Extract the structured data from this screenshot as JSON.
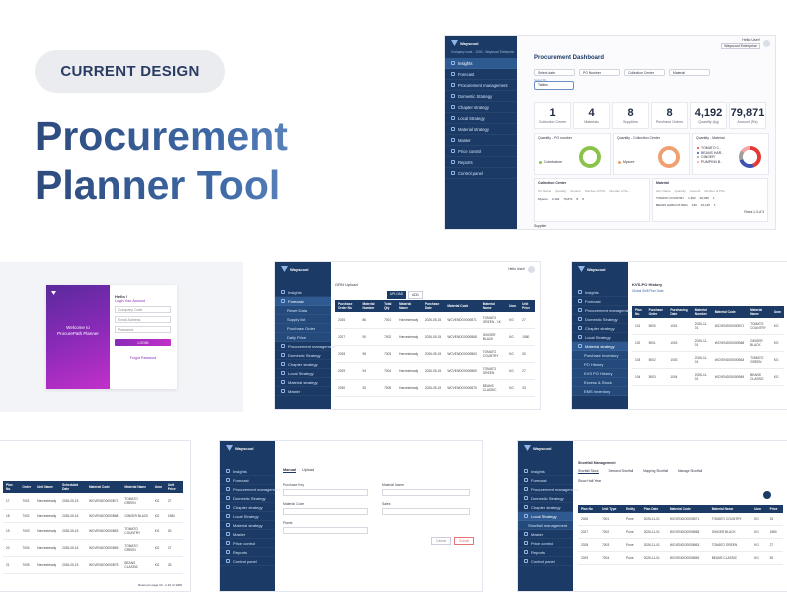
{
  "hero": {
    "badge": "CURRENT DESIGN",
    "title_line1": "Procurement",
    "title_line2": "Planner Tool"
  },
  "dashboard": {
    "brand": "Wayscool",
    "company": "Company code - 1000 - Wayscool Enterprise",
    "nav": [
      "Insights",
      "Forecast",
      "Procurement management",
      "Domestic Strategy",
      "Chapter strategy",
      "Local Strategy",
      "Material strategy",
      "Master",
      "Price control",
      "Reports",
      "Control panel"
    ],
    "user_name": "Hello User!",
    "user_sub": "Wayscool Enterprise",
    "title": "Procurement Dashboard",
    "filters": [
      "Select date",
      "PO Number",
      "Collection Center",
      "Material"
    ],
    "select_by_label": "Select By",
    "select_by_value": "Tables",
    "kpis": [
      {
        "value": "1",
        "label": "Collection Center"
      },
      {
        "value": "4",
        "label": "Materials"
      },
      {
        "value": "8",
        "label": "Suppliers"
      },
      {
        "value": "8",
        "label": "Purchase Orders"
      },
      {
        "value": "4,192",
        "label": "Quantity (kg)"
      },
      {
        "value": "79,871",
        "label": "Amount (Rs)"
      }
    ],
    "donut_titles": [
      "Quantity - PO number",
      "Quantity - Collection Center",
      "Quantity - Material"
    ],
    "donut_legends": [
      "Coimbatore",
      "Mysore"
    ],
    "material_legend": [
      "TOMATO C..",
      "BEANS HAR..",
      "GINGER",
      "PUMPKIN B.."
    ],
    "lower_titles": [
      "Collection Center",
      "Material"
    ],
    "cc_headers": [
      "CC Name",
      "Quantity",
      "Amount",
      "Number of POs",
      "Number of Su..."
    ],
    "cc_row": [
      "Mysore",
      "4,192",
      "79,871",
      "8",
      "8"
    ],
    "mat_headers": [
      "Item Name",
      "Quantity",
      "Amount",
      "Number of POs"
    ],
    "mat_rows": [
      [
        "TOMATO COUNTRY",
        "1,352",
        "36,035",
        "1"
      ],
      [
        "BEANS HARICOT REG",
        "449",
        "10,125",
        "1"
      ]
    ],
    "pager": "Rows 1-3 of 3",
    "footer_label": "Supplier"
  },
  "login": {
    "welcome_1": "Welcome to",
    "welcome_2": "ProcurePath Planner",
    "hello": "Hello !",
    "sub": "Login Your Account",
    "fields": [
      "Company Code",
      "Email Address",
      "Password"
    ],
    "button": "LOGIN",
    "forgot": "Forgot Password"
  },
  "grn": {
    "title": "GRN Upload",
    "tab_active": "UPLOAD",
    "tab_other": "ADD",
    "headers": [
      "Purchase Order No",
      "Material Number",
      "Total Qty",
      "Material Name",
      "Purchase Date",
      "Material Code",
      "Material Name",
      "Uom",
      "Unit Price"
    ],
    "rows": [
      [
        "2026",
        "86",
        "7001",
        "Harvestready",
        "2026-05-15",
        "WCVENDO0000B71",
        "TOMATO GREEN - 1K",
        "KG",
        "27"
      ],
      [
        "2027",
        "90",
        "7002",
        "Harvestready",
        "2026-05-15",
        "WCVENDO0000B68",
        "GINGER BLACK",
        "KG",
        "1580"
      ],
      [
        "2028",
        "96",
        "7003",
        "Harvestready",
        "2026-05-15",
        "WCVENDO0000B63",
        "TOMATO COUNTRY",
        "KG",
        "30"
      ],
      [
        "2029",
        "94",
        "7004",
        "Harvestready",
        "2026-05-15",
        "WCVENDO0000B69",
        "TOMATO GREEN",
        "KG",
        "27"
      ],
      [
        "2030",
        "92",
        "7005",
        "Harvestready",
        "2026-05-15",
        "WCVENDO0000B75",
        "BEANS CLASSIC",
        "KG",
        "33"
      ]
    ],
    "submenu": [
      "Reset Data",
      "Supply list",
      "Purchase Order",
      "Daily Price"
    ]
  },
  "kvs": {
    "title": "KVS-PO History",
    "subtitle": "Global Shift Plan Data",
    "headers": [
      "Plan No.",
      "Purchase Order",
      "Purchasing Date",
      "Material Number",
      "Material Code",
      "Material Name",
      "Uom"
    ],
    "rows": [
      [
        "101",
        "5000",
        "1001",
        "2026-11-01",
        "WCVENDO0000B71",
        "TOMATO COUNTRY",
        "KG"
      ],
      [
        "102",
        "5001",
        "1002",
        "2026-11-01",
        "WCVENDO0000B68",
        "GINGER BLACK",
        "KG"
      ],
      [
        "103",
        "5002",
        "1003",
        "2026-11-01",
        "WCVENDO0000B63",
        "TOMATO GREEN",
        "KG"
      ],
      [
        "104",
        "5003",
        "1004",
        "2026-11-01",
        "WCVENDO0000B69",
        "BEANS CLASSIC",
        "KG"
      ]
    ],
    "submenu": [
      "Purchase Inventory",
      "PO History",
      "KVS PO History",
      "Excess & Stock",
      "EMS Inventory"
    ]
  },
  "po": {
    "headers": [
      "Plan No.",
      "Order",
      "Unit Name",
      "Scheduled Date",
      "Material Code",
      "Material Name",
      "Uom",
      "Unit Price"
    ],
    "rows": [
      [
        "17",
        "7001",
        "Harvestready",
        "2026-05-15",
        "WCVENDO0000B71",
        "TOMATO GREEN",
        "KG",
        "27"
      ],
      [
        "18",
        "7002",
        "Harvestready",
        "2026-05-15",
        "WCVENDO0000B68",
        "GINGER BLACK",
        "KG",
        "1580"
      ],
      [
        "19",
        "7003",
        "Harvestready",
        "2026-05-15",
        "WCVENDO0000B63",
        "TOMATO COUNTRY",
        "KG",
        "30"
      ],
      [
        "20",
        "7004",
        "Harvestready",
        "2026-05-15",
        "WCVENDO0000B69",
        "TOMATO GREEN",
        "KG",
        "27"
      ],
      [
        "21",
        "7005",
        "Harvestready",
        "2026-05-15",
        "WCVENDO0000B75",
        "BEANS CLASSIC",
        "KG",
        "33"
      ]
    ],
    "pager": "Rows per page 10 - 1-10 of 1000"
  },
  "manual": {
    "tabs": [
      "Manual",
      "Upload"
    ],
    "fields_left": [
      "Purchase Key",
      "Material Code",
      "Plants"
    ],
    "fields_right": [
      "Material Name",
      "Sales"
    ],
    "cancel": "Cancel",
    "submit": "Submit"
  },
  "short": {
    "breadcrumb": "Shortfall Management",
    "tabs": [
      "Shortfall Stock",
      "Demand Shortfall",
      "Mapping Shortfall",
      "Manage Shortfall"
    ],
    "section": "Show Half Year",
    "headers": [
      "Plan No",
      "Unit Type",
      "Entity",
      "Plan Date",
      "Material Code",
      "Material Name",
      "Uom",
      "Price"
    ],
    "rows": [
      [
        "2026",
        "7001",
        "Pune",
        "2026-11-01",
        "WCVENDO0000B71",
        "TOMATO COUNTRY",
        "KG",
        "33"
      ],
      [
        "2027",
        "7002",
        "Pune",
        "2026-11-01",
        "WCVENDO0000B68",
        "GINGER BLACK",
        "KG",
        "1580"
      ],
      [
        "2028",
        "7003",
        "Pune",
        "2026-11-01",
        "WCVENDO0000B63",
        "TOMATO GREEN",
        "KG",
        "27"
      ],
      [
        "2029",
        "7004",
        "Pune",
        "2026-11-01",
        "WCVENDO0000B69",
        "BEANS CLASSIC",
        "KG",
        "30"
      ]
    ],
    "sub_item": "Shortfall management"
  }
}
